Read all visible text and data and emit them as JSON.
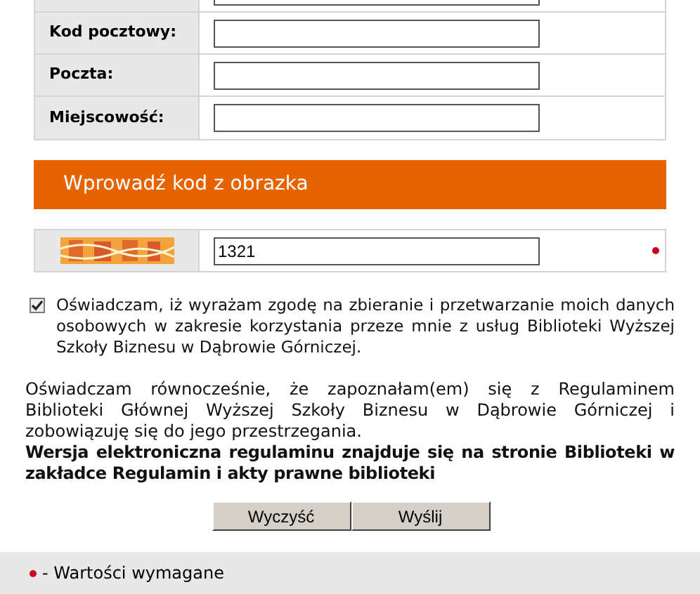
{
  "fields": [
    {
      "kind": "cut"
    },
    {
      "kind": "text",
      "label": "Kod pocztowy:"
    },
    {
      "kind": "text",
      "label": "Poczta:"
    },
    {
      "kind": "text",
      "label": "Miejscowość:"
    }
  ],
  "captcha": {
    "heading": "Wprowadź kod z obrazka",
    "value": "1321",
    "required": true
  },
  "consent": {
    "checked": true,
    "text": "Oświadczam, iż wyrażam zgodę na zbieranie i przetwarzanie moich danych osobowych w zakresie korzystania przeze mnie z usług Biblioteki Wyższej Szkoły Biznesu w Dąbrowie Górniczej."
  },
  "statement": "Oświadczam równocześnie, że zapoznałam(em) się z Regulaminem Biblioteki Głównej Wyższej Szkoły Biznesu w Dąbrowie Górniczej i zobowiązuję się do jego przestrzegania.",
  "note": "Wersja elektroniczna regulaminu znajduje się na stronie Biblioteki w zakładce Regulamin i akty prawne biblioteki",
  "buttons": [
    "Wyczyść",
    "Wyślij"
  ],
  "legend": "- Wartości wymagane"
}
